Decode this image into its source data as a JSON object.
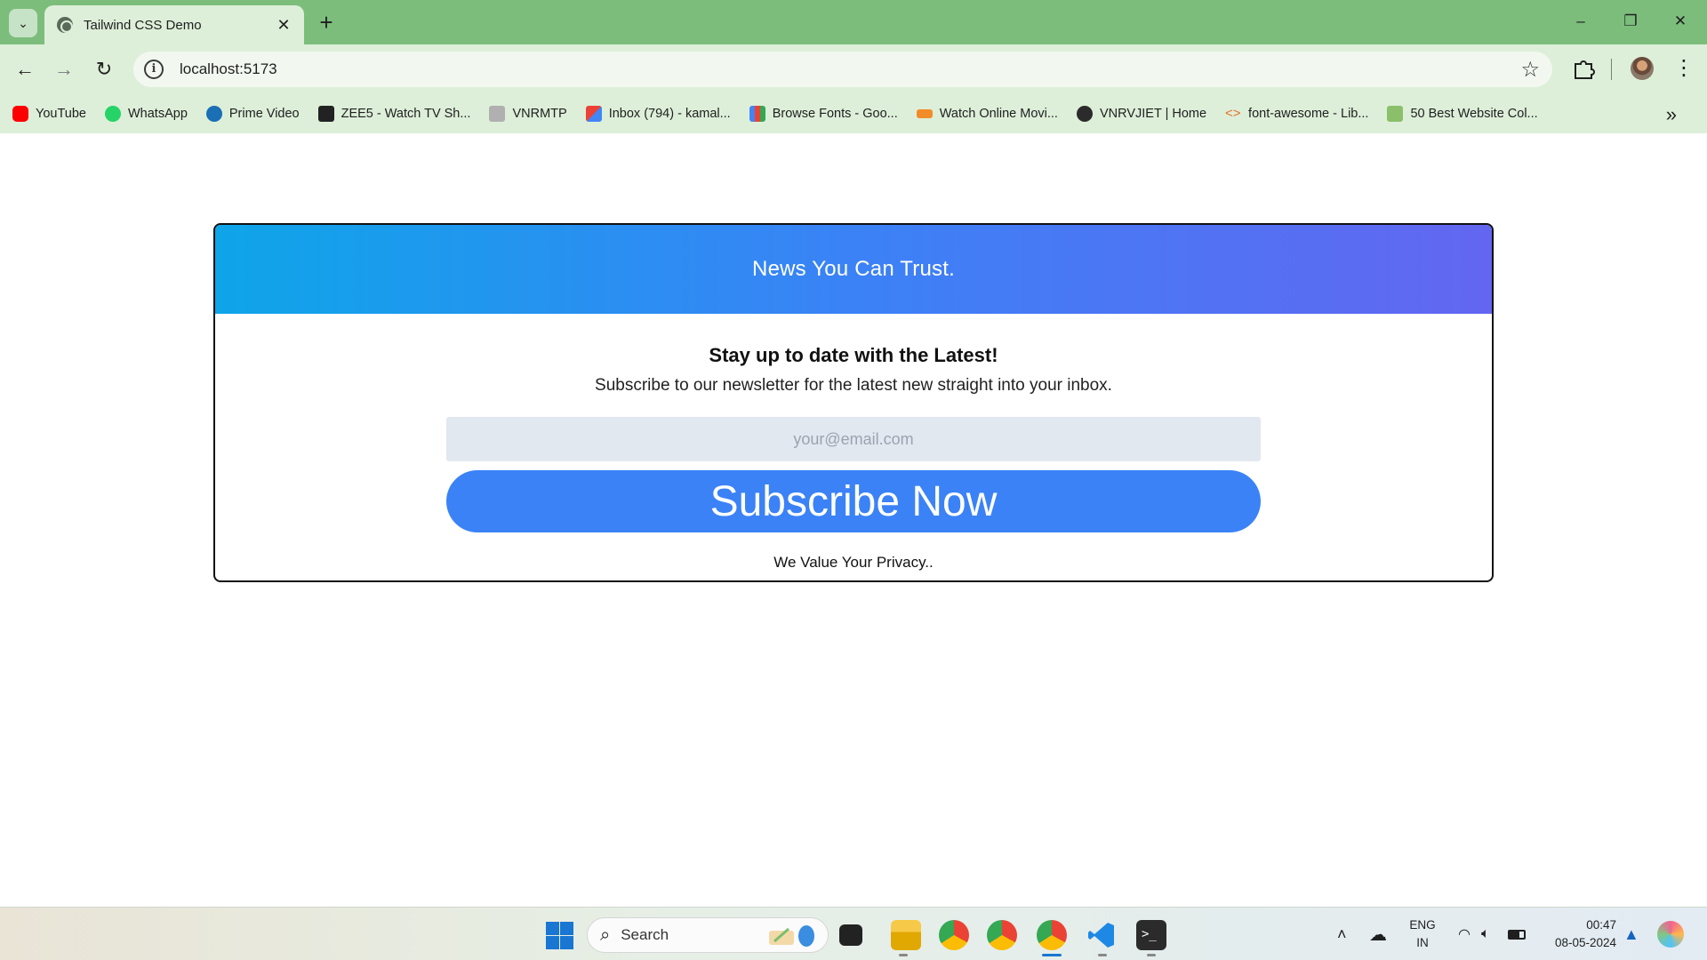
{
  "browser": {
    "tab_title": "Tailwind CSS Demo",
    "url": "localhost:5173",
    "bookmarks": [
      {
        "label": "YouTube",
        "icon": "youtube-icon",
        "color": "#ff0000"
      },
      {
        "label": "WhatsApp",
        "icon": "whatsapp-icon",
        "color": "#25d366"
      },
      {
        "label": "Prime Video",
        "icon": "prime-video-icon",
        "color": "#1a98ff"
      },
      {
        "label": "ZEE5 - Watch TV Sh...",
        "icon": "zee5-icon",
        "color": "#222222"
      },
      {
        "label": "VNRMTP",
        "icon": "vnrmtp-icon",
        "color": "#8a8a8a"
      },
      {
        "label": "Inbox (794) - kamal...",
        "icon": "gmail-icon",
        "color": "#ea4335"
      },
      {
        "label": "Browse Fonts - Goo...",
        "icon": "google-fonts-icon",
        "color": "#4285f4"
      },
      {
        "label": "Watch Online Movi...",
        "icon": "movie-site-icon",
        "color": "#f28c28"
      },
      {
        "label": "VNRVJIET | Home",
        "icon": "globe-icon",
        "color": "#2b2b2b"
      },
      {
        "label": "font-awesome - Lib...",
        "icon": "code-icon",
        "color": "#e8702a"
      },
      {
        "label": "50 Best Website Col...",
        "icon": "site-d-icon",
        "color": "#8bbf6a"
      }
    ]
  },
  "page": {
    "header_title": "News You Can Trust.",
    "heading": "Stay up to date with the Latest!",
    "subtext": "Subscribe to our newsletter for the latest new straight into your inbox.",
    "email_placeholder": "your@email.com",
    "button_label": "Subscribe Now",
    "privacy_note": "We Value Your Privacy..",
    "gradient_start": "#0ea5e9",
    "gradient_end": "#6366f1",
    "button_color": "#3b82f6"
  },
  "taskbar": {
    "search_label": "Search",
    "language": "ENG",
    "region": "IN",
    "time": "00:47",
    "date": "08-05-2024"
  }
}
